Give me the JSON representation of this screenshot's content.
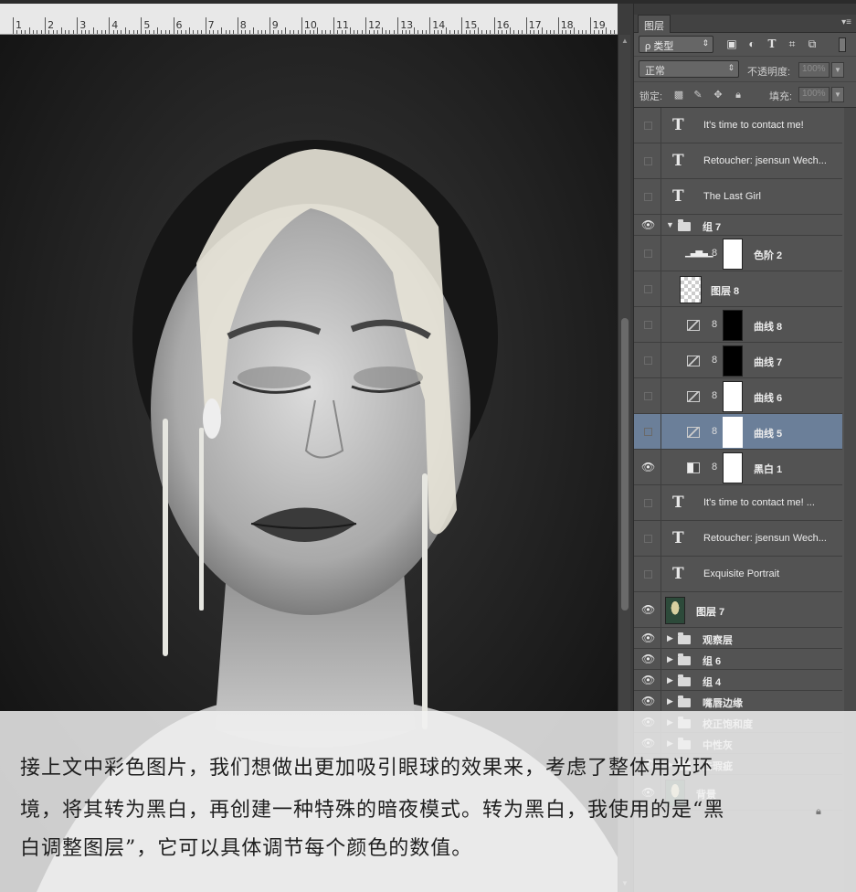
{
  "ruler": {
    "numbers": [
      "1",
      "2",
      "3",
      "4",
      "5",
      "6",
      "7",
      "8",
      "9",
      "10",
      "11",
      "12",
      "13",
      "14",
      "15",
      "16",
      "17",
      "18",
      "19"
    ]
  },
  "panel": {
    "tab_label": "图层",
    "filter_label": "ρ 类型",
    "filter_icons": [
      "image-icon",
      "adjustment-icon",
      "type-icon",
      "shape-icon",
      "smart-object-icon",
      "toggle-icon"
    ],
    "blend_mode": "正常",
    "opacity_label": "不透明度:",
    "opacity_value": "100%",
    "lock_label": "锁定:",
    "fill_label": "填充:",
    "fill_value": "100%"
  },
  "layers": [
    {
      "kind": "text",
      "name": "It's time to contact me!",
      "visible": false
    },
    {
      "kind": "text",
      "name": "Retoucher: jsensun Wech...",
      "visible": false
    },
    {
      "kind": "text",
      "name": "The Last Girl",
      "visible": false
    },
    {
      "kind": "group-open",
      "name": "组 7",
      "visible": true
    },
    {
      "kind": "levels",
      "name": "色阶 2",
      "visible": false
    },
    {
      "kind": "pixel",
      "name": "图层 8",
      "visible": false
    },
    {
      "kind": "curves",
      "name": "曲线 8",
      "visible": false,
      "mask": "dark"
    },
    {
      "kind": "curves",
      "name": "曲线 7",
      "visible": false,
      "mask": "dark"
    },
    {
      "kind": "curves",
      "name": "曲线 6",
      "visible": false,
      "mask": "light"
    },
    {
      "kind": "curves",
      "name": "曲线 5",
      "visible": false,
      "mask": "light",
      "selected": true
    },
    {
      "kind": "bw",
      "name": "黑白 1",
      "visible": true
    },
    {
      "kind": "text",
      "name": "It's time to contact me! ...",
      "visible": false
    },
    {
      "kind": "text",
      "name": "Retoucher: jsensun Wech...",
      "visible": false
    },
    {
      "kind": "text",
      "name": "Exquisite Portrait",
      "visible": false
    },
    {
      "kind": "photo",
      "name": "图层 7",
      "visible": true
    },
    {
      "kind": "group",
      "name": "观察层",
      "visible": true
    },
    {
      "kind": "group",
      "name": "组 6",
      "visible": true
    },
    {
      "kind": "group",
      "name": "组 4",
      "visible": true
    },
    {
      "kind": "group",
      "name": "嘴唇边缘",
      "visible": true
    },
    {
      "kind": "group",
      "name": "校正饱和度",
      "visible": true
    },
    {
      "kind": "group",
      "name": "中性灰",
      "visible": true
    },
    {
      "kind": "group",
      "name": "去瑕疵",
      "visible": true
    },
    {
      "kind": "photo",
      "name": "背景",
      "visible": true
    }
  ],
  "overlay": {
    "lines": [
      "接上文中彩色图片，我们想做出更加吸引眼球的效果来，考虑了整体用光环",
      "境，将其转为黑白，再创建一种特殊的暗夜模式。转为黑白，我使用的是“黑",
      "白调整图层”，它可以具体调节每个颜色的数值。"
    ]
  }
}
